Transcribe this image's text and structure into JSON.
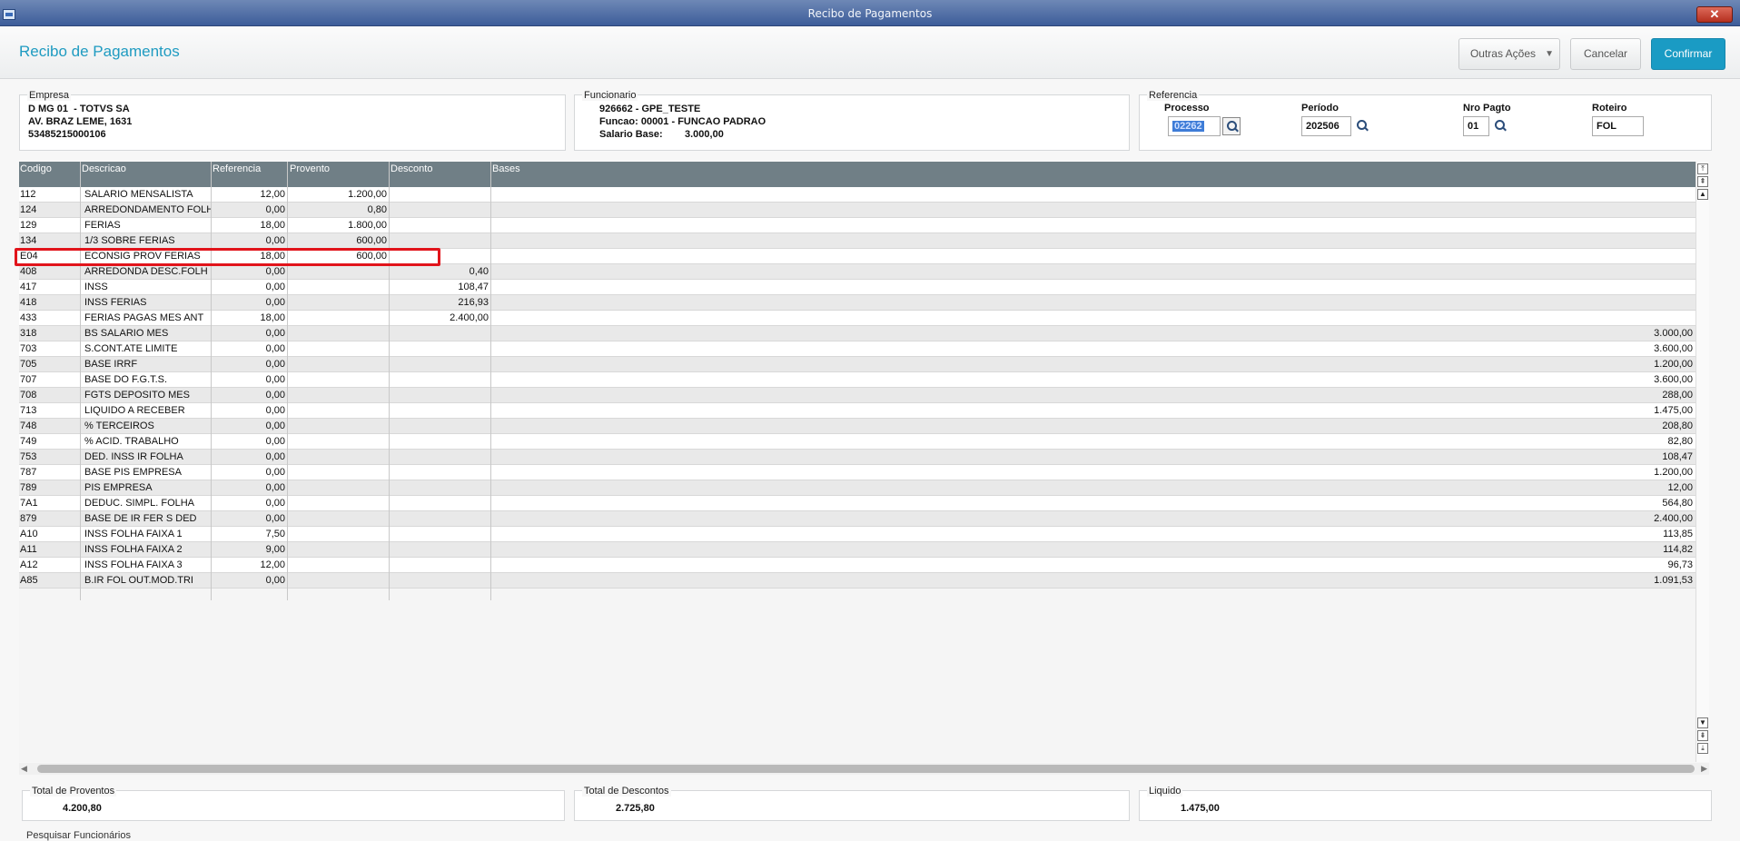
{
  "window": {
    "title": "Recibo de Pagamentos",
    "close": "✕"
  },
  "header": {
    "title": "Recibo de Pagamentos",
    "outras_acoes": "Outras Ações",
    "cancelar": "Cancelar",
    "confirmar": "Confirmar"
  },
  "empresa": {
    "legend": "Empresa",
    "line1": "D MG 01  - TOTVS SA",
    "line2": "AV. BRAZ LEME, 1631",
    "line3": "53485215000106"
  },
  "funcionario": {
    "legend": "Funcionario",
    "line1": "926662 - GPE_TESTE",
    "line2": "Funcao: 00001 - FUNCAO PADRAO",
    "salario_label": "Salario Base:",
    "salario_value": "3.000,00"
  },
  "referencia": {
    "legend": "Referencia",
    "processo_label": "Processo",
    "processo_value": "02262",
    "periodo_label": "Período",
    "periodo_value": "202506",
    "nro_pagto_label": "Nro Pagto",
    "nro_pagto_value": "01",
    "roteiro_label": "Roteiro",
    "roteiro_value": "FOL"
  },
  "grid": {
    "columns": [
      "Codigo",
      "Descricao",
      "Referencia",
      "Provento",
      "Desconto",
      "Bases"
    ],
    "rows": [
      {
        "codigo": "112",
        "descricao": "SALARIO MENSALISTA",
        "referencia": "12,00",
        "provento": "1.200,00",
        "desconto": "",
        "bases": ""
      },
      {
        "codigo": "124",
        "descricao": "ARREDONDAMENTO FOLH",
        "referencia": "0,00",
        "provento": "0,80",
        "desconto": "",
        "bases": ""
      },
      {
        "codigo": "129",
        "descricao": "FERIAS",
        "referencia": "18,00",
        "provento": "1.800,00",
        "desconto": "",
        "bases": ""
      },
      {
        "codigo": "134",
        "descricao": "1/3 SOBRE FERIAS",
        "referencia": "0,00",
        "provento": "600,00",
        "desconto": "",
        "bases": ""
      },
      {
        "codigo": "E04",
        "descricao": "ECONSIG PROV FERIAS",
        "referencia": "18,00",
        "provento": "600,00",
        "desconto": "",
        "bases": ""
      },
      {
        "codigo": "408",
        "descricao": "ARREDONDA DESC.FOLH",
        "referencia": "0,00",
        "provento": "",
        "desconto": "0,40",
        "bases": ""
      },
      {
        "codigo": "417",
        "descricao": "INSS",
        "referencia": "0,00",
        "provento": "",
        "desconto": "108,47",
        "bases": ""
      },
      {
        "codigo": "418",
        "descricao": "INSS FERIAS",
        "referencia": "0,00",
        "provento": "",
        "desconto": "216,93",
        "bases": ""
      },
      {
        "codigo": "433",
        "descricao": "FERIAS PAGAS MES ANT",
        "referencia": "18,00",
        "provento": "",
        "desconto": "2.400,00",
        "bases": ""
      },
      {
        "codigo": "318",
        "descricao": "BS SALARIO MES",
        "referencia": "0,00",
        "provento": "",
        "desconto": "",
        "bases": "3.000,00"
      },
      {
        "codigo": "703",
        "descricao": "S.CONT.ATE LIMITE",
        "referencia": "0,00",
        "provento": "",
        "desconto": "",
        "bases": "3.600,00"
      },
      {
        "codigo": "705",
        "descricao": "BASE IRRF",
        "referencia": "0,00",
        "provento": "",
        "desconto": "",
        "bases": "1.200,00"
      },
      {
        "codigo": "707",
        "descricao": "BASE DO F.G.T.S.",
        "referencia": "0,00",
        "provento": "",
        "desconto": "",
        "bases": "3.600,00"
      },
      {
        "codigo": "708",
        "descricao": "FGTS DEPOSITO MES",
        "referencia": "0,00",
        "provento": "",
        "desconto": "",
        "bases": "288,00"
      },
      {
        "codigo": "713",
        "descricao": "LIQUIDO A RECEBER",
        "referencia": "0,00",
        "provento": "",
        "desconto": "",
        "bases": "1.475,00"
      },
      {
        "codigo": "748",
        "descricao": "% TERCEIROS",
        "referencia": "0,00",
        "provento": "",
        "desconto": "",
        "bases": "208,80"
      },
      {
        "codigo": "749",
        "descricao": "% ACID. TRABALHO",
        "referencia": "0,00",
        "provento": "",
        "desconto": "",
        "bases": "82,80"
      },
      {
        "codigo": "753",
        "descricao": "DED. INSS IR FOLHA",
        "referencia": "0,00",
        "provento": "",
        "desconto": "",
        "bases": "108,47"
      },
      {
        "codigo": "787",
        "descricao": "BASE PIS EMPRESA",
        "referencia": "0,00",
        "provento": "",
        "desconto": "",
        "bases": "1.200,00"
      },
      {
        "codigo": "789",
        "descricao": "PIS EMPRESA",
        "referencia": "0,00",
        "provento": "",
        "desconto": "",
        "bases": "12,00"
      },
      {
        "codigo": "7A1",
        "descricao": "DEDUC. SIMPL. FOLHA",
        "referencia": "0,00",
        "provento": "",
        "desconto": "",
        "bases": "564,80"
      },
      {
        "codigo": "879",
        "descricao": "BASE DE IR FER S DED",
        "referencia": "0,00",
        "provento": "",
        "desconto": "",
        "bases": "2.400,00"
      },
      {
        "codigo": "A10",
        "descricao": "INSS FOLHA FAIXA 1",
        "referencia": "7,50",
        "provento": "",
        "desconto": "",
        "bases": "113,85"
      },
      {
        "codigo": "A11",
        "descricao": "INSS FOLHA FAIXA 2",
        "referencia": "9,00",
        "provento": "",
        "desconto": "",
        "bases": "114,82"
      },
      {
        "codigo": "A12",
        "descricao": "INSS FOLHA FAIXA 3",
        "referencia": "12,00",
        "provento": "",
        "desconto": "",
        "bases": "96,73"
      },
      {
        "codigo": "A85",
        "descricao": "B.IR FOL OUT.MOD.TRI",
        "referencia": "0,00",
        "provento": "",
        "desconto": "",
        "bases": "1.091,53"
      }
    ]
  },
  "totals": {
    "proventos_label": "Total de Proventos",
    "proventos_value": "4.200,80",
    "descontos_label": "Total de Descontos",
    "descontos_value": "2.725,80",
    "liquido_label": "Liquido",
    "liquido_value": "1.475,00"
  },
  "footer": {
    "pesquisar": "Pesquisar Funcionários"
  },
  "colors": {
    "accent": "#1a9bc4",
    "grid_header": "#707f86",
    "highlight": "#e1141b"
  },
  "icons": {
    "window": "window-icon",
    "search": "magnifier-icon",
    "caret": "caret-down-icon"
  }
}
